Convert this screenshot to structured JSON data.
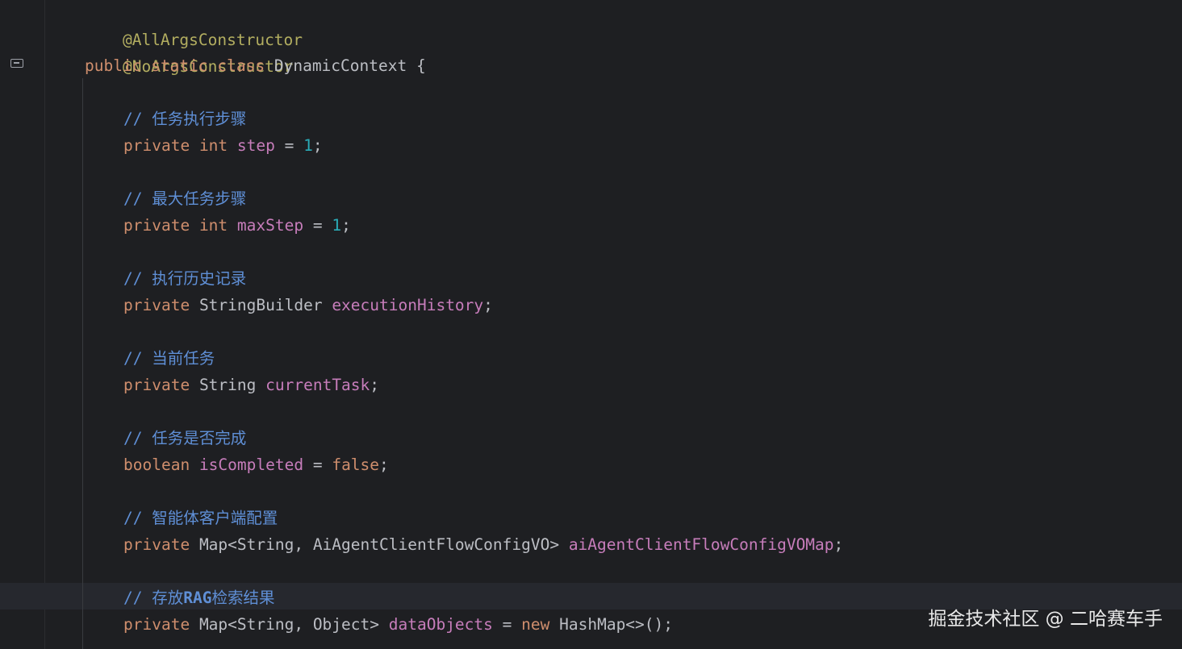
{
  "editor": {
    "lines": {
      "annot_all_args": "@AllArgsConstructor",
      "annot_no_args": "@NoArgsConstructor",
      "class_decl": {
        "kw_public": "public",
        "kw_static": "static",
        "kw_class": "class",
        "class_name": "DynamicContext",
        "brace": "{"
      },
      "comment_step": {
        "slashes": "//",
        "text": "任务执行步骤"
      },
      "field_step": {
        "kw_private": "private",
        "kw_type": "int",
        "name": "step",
        "op": "=",
        "value": "1",
        "end": ";"
      },
      "comment_max_step": {
        "slashes": "//",
        "text": "最大任务步骤"
      },
      "field_max_step": {
        "kw_private": "private",
        "kw_type": "int",
        "name": "maxStep",
        "op": "=",
        "value": "1",
        "end": ";"
      },
      "comment_history": {
        "slashes": "//",
        "text": "执行历史记录"
      },
      "field_history": {
        "kw_private": "private",
        "type": "StringBuilder",
        "name": "executionHistory",
        "end": ";"
      },
      "comment_current_task": {
        "slashes": "//",
        "text": "当前任务"
      },
      "field_current_task": {
        "kw_private": "private",
        "type": "String",
        "name": "currentTask",
        "end": ";"
      },
      "comment_completed": {
        "slashes": "//",
        "text": "任务是否完成"
      },
      "field_completed": {
        "kw_type": "boolean",
        "name": "isCompleted",
        "op": "=",
        "value": "false",
        "end": ";"
      },
      "comment_agent_config": {
        "slashes": "//",
        "text": "智能体客户端配置"
      },
      "field_agent_config": {
        "kw_private": "private",
        "type": "Map<String, AiAgentClientFlowConfigVO>",
        "name": "aiAgentClientFlowConfigVOMap",
        "end": ";"
      },
      "comment_rag": {
        "slashes": "//",
        "text_a": "存放",
        "text_b": "RAG",
        "text_c": "检索结果"
      },
      "field_data_objects": {
        "kw_private": "private",
        "type": "Map<String, Object>",
        "name": "dataObjects",
        "op": "=",
        "kw_new": "new",
        "ctor": "HashMap<>()",
        "end": ";"
      }
    }
  },
  "watermark": {
    "text": "掘金技术社区 @ 二哈赛车手"
  },
  "colors": {
    "background": "#1e1f22",
    "keyword": "#cf8e6d",
    "annotation": "#b3ae60",
    "field": "#c77dbb",
    "number": "#2aacb8",
    "comment": "#5f8fd6",
    "text": "#bcbec4"
  },
  "icons": {
    "gutter": "structure-icon"
  }
}
